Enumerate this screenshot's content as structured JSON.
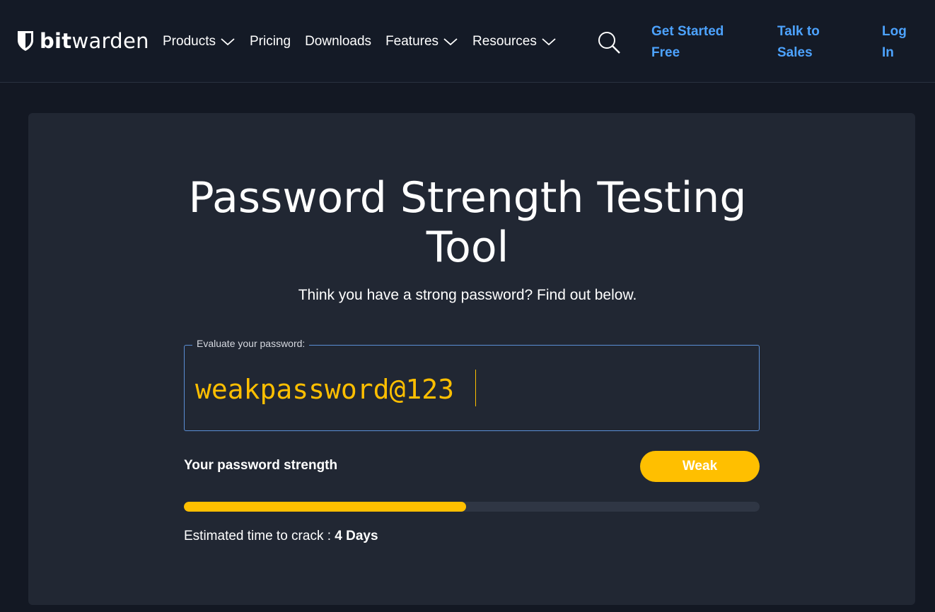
{
  "brand": {
    "bold": "bit",
    "rest": "warden"
  },
  "nav": {
    "products": "Products",
    "pricing": "Pricing",
    "downloads": "Downloads",
    "features": "Features",
    "resources": "Resources"
  },
  "cta": {
    "get_started_line1": "Get Started",
    "get_started_line2": "Free",
    "talk_line1": "Talk to",
    "talk_line2": "Sales",
    "login_line1": "Log",
    "login_line2": "In"
  },
  "tool": {
    "title_line1": "Password Strength Testing",
    "title_line2": "Tool",
    "subtitle": "Think you have a strong password? Find out below.",
    "field_label": "Evaluate your password:",
    "password_value": "weakpassword@123",
    "strength_label": "Your password strength",
    "strength_value": "Weak",
    "strength_fraction": 0.49,
    "crack_prefix": "Estimated time to crack : ",
    "crack_value": "4 Days"
  },
  "colors": {
    "background": "#131823",
    "card": "#212733",
    "accent_link": "#4da3ff",
    "strength_weak": "#ffbf00",
    "field_border": "#5b8fd6"
  },
  "icons": [
    "bitwarden-shield-icon",
    "chevron-down-icon",
    "search-icon"
  ]
}
